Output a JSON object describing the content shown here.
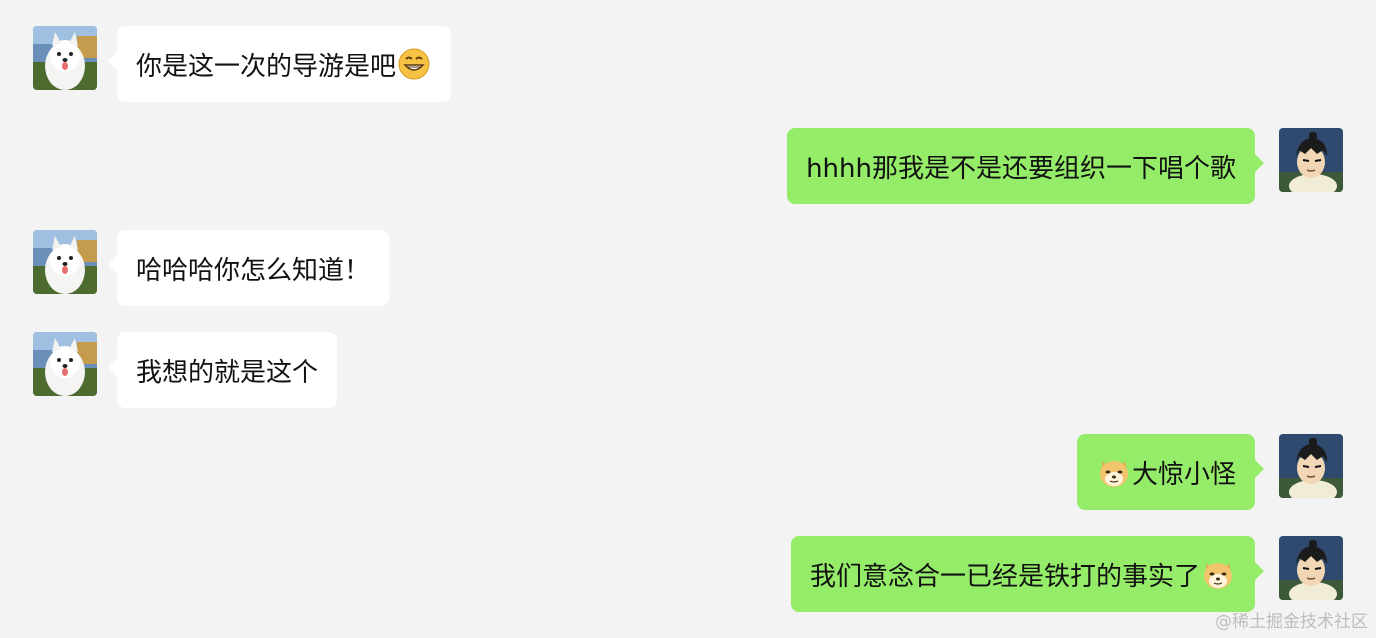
{
  "messages": [
    {
      "side": "left",
      "avatar": "samoyed-dog-avatar",
      "text": "你是这一次的导游是吧",
      "trailing_emoji": "grin-emoji"
    },
    {
      "side": "right",
      "avatar": "anime-boy-avatar",
      "text": "hhhh那我是不是还要组织一下唱个歌"
    },
    {
      "side": "left",
      "avatar": "samoyed-dog-avatar",
      "text": "哈哈哈你怎么知道！"
    },
    {
      "side": "left",
      "avatar": "samoyed-dog-avatar",
      "text": "我想的就是这个"
    },
    {
      "side": "right",
      "avatar": "anime-boy-avatar",
      "leading_emoji": "doge-emoji",
      "text": "大惊小怪"
    },
    {
      "side": "right",
      "avatar": "anime-boy-avatar",
      "text": "我们意念合一已经是铁打的事实了",
      "trailing_emoji": "doge-emoji"
    }
  ],
  "watermark": "@稀土掘金技术社区",
  "colors": {
    "background": "#f3f3f3",
    "incoming_bubble": "#ffffff",
    "outgoing_bubble": "#95ec69",
    "text": "#111111"
  }
}
